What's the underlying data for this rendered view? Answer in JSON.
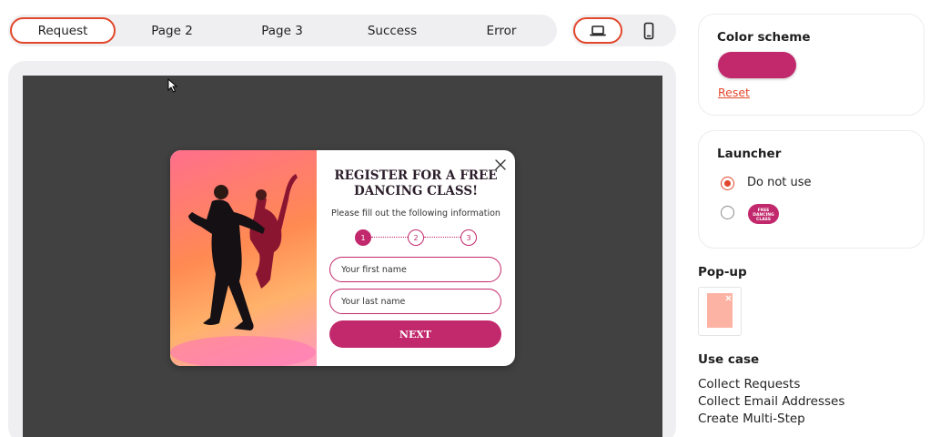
{
  "steps": {
    "tabs": [
      {
        "label": "Request",
        "active": true
      },
      {
        "label": "Page 2"
      },
      {
        "label": "Page 3"
      },
      {
        "label": "Success"
      },
      {
        "label": "Error"
      }
    ]
  },
  "devices": {
    "selected": "desktop",
    "items": [
      "laptop-icon",
      "mobile-icon"
    ]
  },
  "popup": {
    "title": "REGISTER FOR A FREE DANCING CLASS!",
    "subtitle": "Please fill out the following information",
    "steps": [
      "1",
      "2",
      "3"
    ],
    "current_step": 1,
    "first_name_placeholder": "Your first name",
    "last_name_placeholder": "Your last name",
    "next_label": "NEXT"
  },
  "sidebar": {
    "color_scheme": {
      "title": "Color scheme",
      "color": "#c2286c",
      "reset_label": "Reset"
    },
    "launcher": {
      "title": "Launcher",
      "options": [
        {
          "label": "Do not use",
          "selected": true
        },
        {
          "badge": "FREE DANCING CLASS",
          "selected": false
        }
      ]
    },
    "popup": {
      "title": "Pop-up"
    },
    "use_case": {
      "title": "Use case",
      "items": [
        "Collect Requests",
        "Collect Email Addresses",
        "Create Multi-Step"
      ]
    }
  },
  "colors": {
    "accent": "#e2472b",
    "brand": "#c2286c",
    "canvas": "#414141"
  }
}
